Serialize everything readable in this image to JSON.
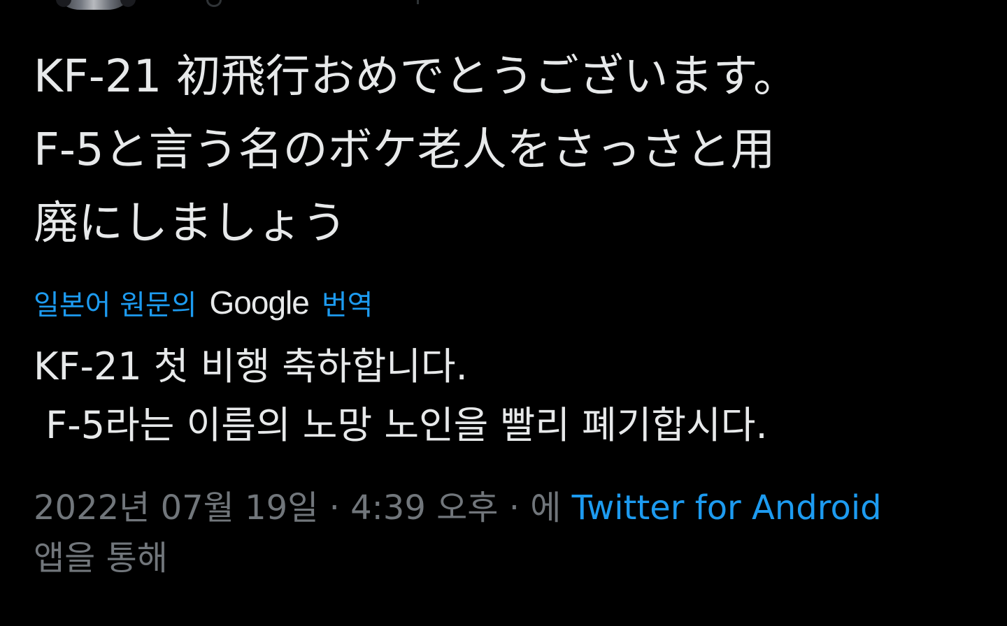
{
  "tweet": {
    "text": "KF-21 初飛行おめでとうございます。\nF-5と言う名のボケ老人をさっさと用\n廃にしましょう"
  },
  "translation": {
    "prefix": "일본어 원문의",
    "provider": "Google",
    "suffix": "번역",
    "text": "KF-21 첫 비행 축하합니다.\n F-5라는 이름의 노망 노인을 빨리 폐기합시다."
  },
  "meta": {
    "timestamp": "2022년 07월 19일 · 4:39 오후 · 에",
    "source_app": "Twitter for Android",
    "source_suffix": "앱을 통해"
  },
  "colors": {
    "background": "#000000",
    "text": "#e7e9ea",
    "link": "#1d9bf0",
    "muted": "#71767b"
  }
}
